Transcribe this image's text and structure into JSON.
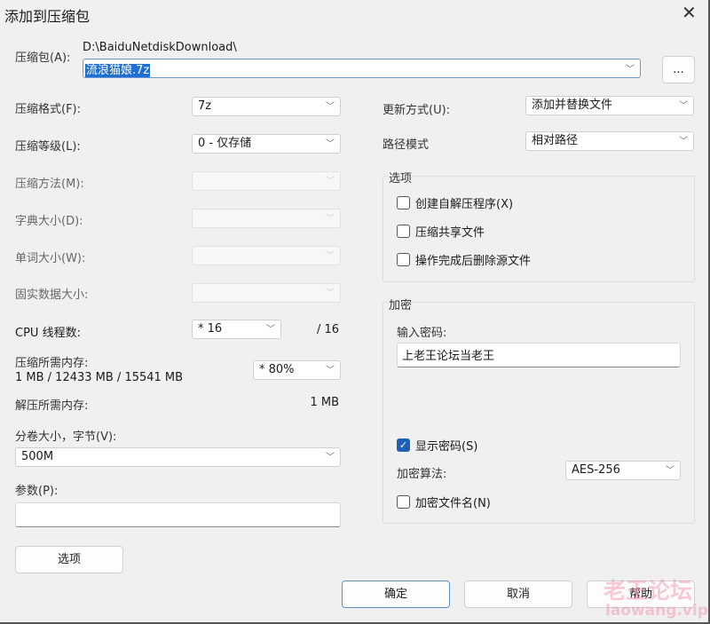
{
  "title": "添加到压缩包",
  "archive": {
    "label": "压缩包(A):",
    "path": "D:\\BaiduNetdiskDownload\\",
    "filename": "流浪猫娘.7z",
    "browse": "..."
  },
  "left": {
    "format": {
      "label": "压缩格式(F):",
      "value": "7z"
    },
    "level": {
      "label": "压缩等级(L):",
      "value": "0 - 仅存储"
    },
    "method": {
      "label": "压缩方法(M):"
    },
    "dict": {
      "label": "字典大小(D):"
    },
    "word": {
      "label": "单词大小(W):"
    },
    "solid": {
      "label": "固实数据大小:"
    },
    "cpu": {
      "label": "CPU 线程数:",
      "value": "* 16",
      "max": "/ 16"
    },
    "mem": {
      "label": "压缩所需内存:",
      "value": "1 MB / 12433 MB / 15541 MB",
      "select": "* 80%"
    },
    "decomp": {
      "label": "解压所需内存:",
      "value": "1 MB"
    },
    "volume": {
      "label": "分卷大小，字节(V):",
      "value": "500M"
    },
    "params": {
      "label": "参数(P):",
      "value": ""
    },
    "options_button": "选项"
  },
  "right": {
    "update": {
      "label": "更新方式(U):",
      "value": "添加并替换文件"
    },
    "pathmode": {
      "label": "路径模式",
      "value": "相对路径"
    },
    "options": {
      "title": "选项",
      "items": [
        {
          "label": "创建自解压程序(X)",
          "checked": false
        },
        {
          "label": "压缩共享文件",
          "checked": false
        },
        {
          "label": "操作完成后删除源文件",
          "checked": false
        }
      ]
    },
    "encrypt": {
      "title": "加密",
      "pw_label": "输入密码:",
      "password": "上老王论坛当老王",
      "show_pw": "显示密码(S)",
      "alg_label": "加密算法:",
      "alg": "AES-256",
      "enc_names": "加密文件名(N)"
    }
  },
  "buttons": {
    "ok": "确定",
    "cancel": "取消",
    "help": "帮助"
  },
  "watermark": {
    "cn": "老王论坛",
    "url": "laowang.vip"
  }
}
